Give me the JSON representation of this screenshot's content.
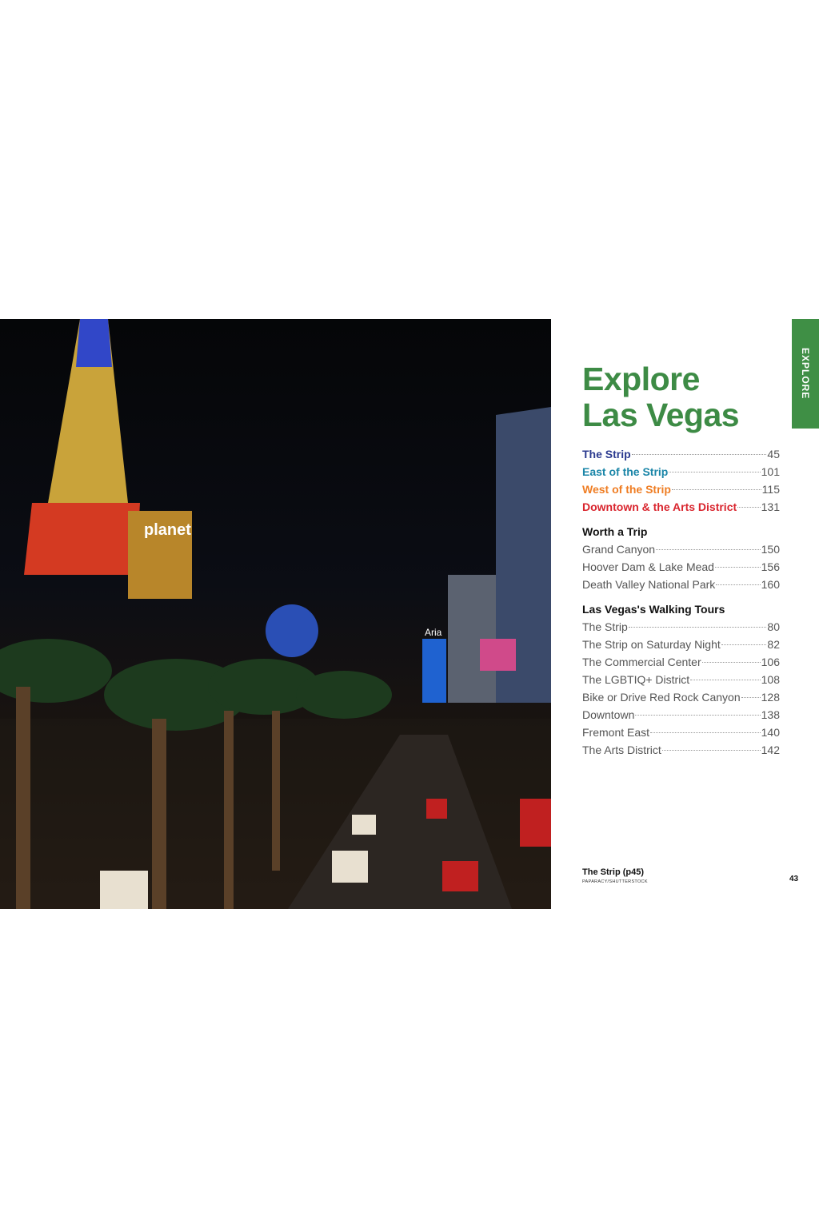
{
  "tab": "EXPLORE",
  "title": [
    "Explore",
    "Las Vegas"
  ],
  "regions": [
    {
      "label": "The Strip",
      "page": "45",
      "color": "#2b3a8f"
    },
    {
      "label": "East of the Strip",
      "page": "101",
      "color": "#1b86a8"
    },
    {
      "label": "West of the Strip",
      "page": "115",
      "color": "#ef7d23"
    },
    {
      "label": "Downtown & the Arts District",
      "page": "131",
      "color": "#d9252e"
    }
  ],
  "worth": {
    "heading": "Worth a Trip",
    "items": [
      {
        "label": "Grand Canyon",
        "page": "150"
      },
      {
        "label": "Hoover Dam & Lake Mead",
        "page": "156"
      },
      {
        "label": "Death Valley National Park",
        "page": "160"
      }
    ]
  },
  "tours": {
    "heading": "Las Vegas's Walking Tours",
    "items": [
      {
        "label": "The Strip",
        "page": "80"
      },
      {
        "label": "The Strip on Saturday Night",
        "page": "82"
      },
      {
        "label": "The Commercial Center",
        "page": "106"
      },
      {
        "label": "The LGBTIQ+ District",
        "page": "108"
      },
      {
        "label": "Bike or Drive Red Rock Canyon",
        "page": "128"
      },
      {
        "label": "Downtown",
        "page": "138"
      },
      {
        "label": "Fremont East",
        "page": "140"
      },
      {
        "label": "The Arts District",
        "page": "142"
      }
    ]
  },
  "caption": "The Strip (p45)",
  "credit": "PAPARACY/SHUTTERSTOCK",
  "page_number": "43",
  "photo_signs": [
    "planet",
    "Aria"
  ]
}
